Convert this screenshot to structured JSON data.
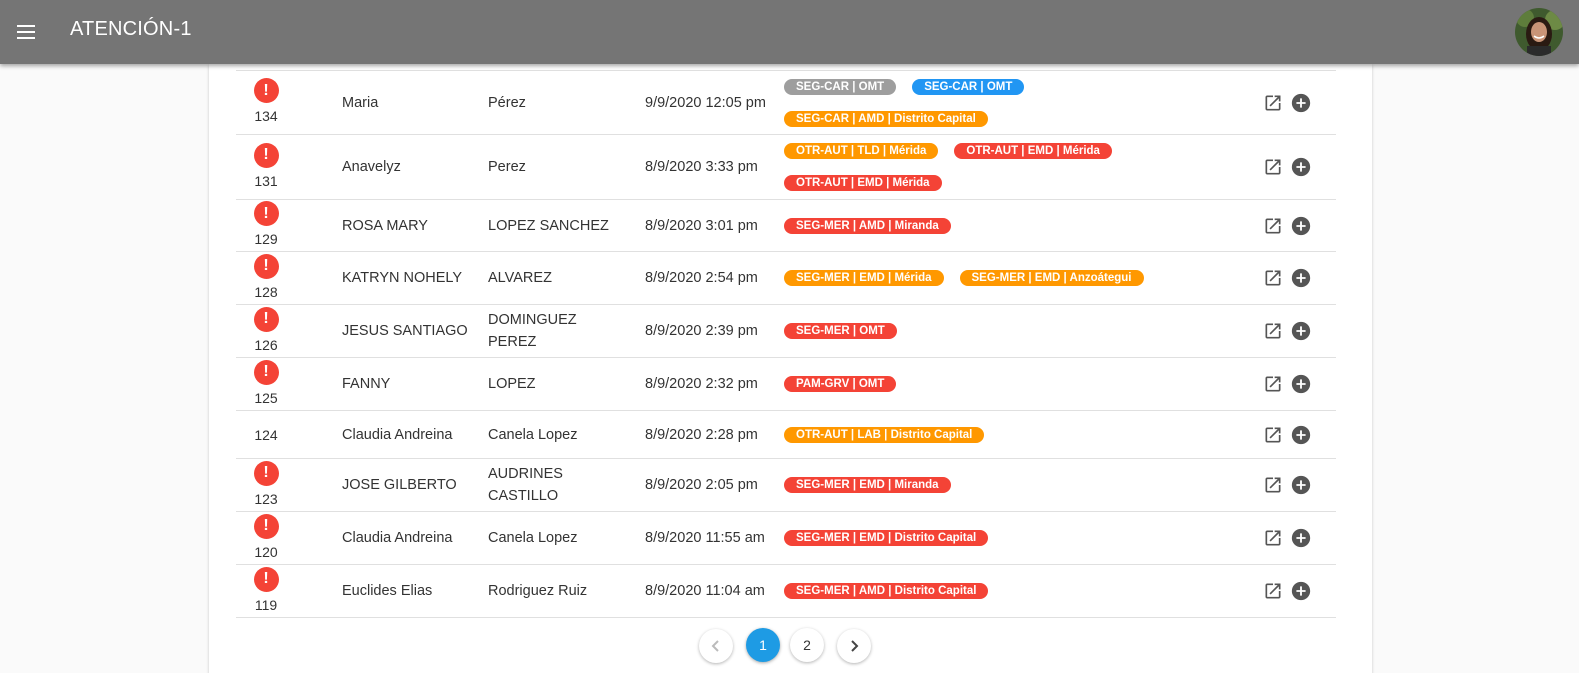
{
  "app": {
    "title": "ATENCIÓN-1"
  },
  "colors": {
    "red": "#f44336",
    "orange": "#ff9800",
    "gray": "#9e9e9e",
    "blue": "#2196f3",
    "active_page": "#1e9be4"
  },
  "rows": [
    {
      "id": "134",
      "alert": true,
      "first": "Maria",
      "last": "Pérez",
      "date": "9/9/2020 12:05 pm",
      "tags": [
        {
          "label": "SEG-CAR | OMT",
          "color": "gray"
        },
        {
          "label": "SEG-CAR | OMT",
          "color": "blue"
        },
        {
          "label": "SEG-CAR | AMD | Distrito Capital",
          "color": "orange"
        }
      ]
    },
    {
      "id": "131",
      "alert": true,
      "first": "Anavelyz",
      "last": "Perez",
      "date": "8/9/2020 3:33 pm",
      "tags": [
        {
          "label": "OTR-AUT | TLD | Mérida",
          "color": "orange"
        },
        {
          "label": "OTR-AUT | EMD | Mérida",
          "color": "red"
        },
        {
          "label": "OTR-AUT | EMD | Mérida",
          "color": "red"
        }
      ]
    },
    {
      "id": "129",
      "alert": true,
      "first": "ROSA MARY",
      "last": "LOPEZ SANCHEZ",
      "date": "8/9/2020 3:01 pm",
      "tags": [
        {
          "label": "SEG-MER | AMD | Miranda",
          "color": "red"
        }
      ]
    },
    {
      "id": "128",
      "alert": true,
      "first": "KATRYN NOHELY",
      "last": "ALVAREZ",
      "date": "8/9/2020 2:54 pm",
      "tags": [
        {
          "label": "SEG-MER | EMD | Mérida",
          "color": "orange"
        },
        {
          "label": "SEG-MER | EMD | Anzoátegui",
          "color": "orange"
        }
      ]
    },
    {
      "id": "126",
      "alert": true,
      "first": "JESUS SANTIAGO",
      "last": "DOMINGUEZ PEREZ",
      "date": "8/9/2020 2:39 pm",
      "tags": [
        {
          "label": "SEG-MER | OMT",
          "color": "red"
        }
      ]
    },
    {
      "id": "125",
      "alert": true,
      "first": "FANNY",
      "last": "LOPEZ",
      "date": "8/9/2020 2:32 pm",
      "tags": [
        {
          "label": "PAM-GRV | OMT",
          "color": "red"
        }
      ]
    },
    {
      "id": "124",
      "alert": false,
      "first": "Claudia Andreina",
      "last": "Canela Lopez",
      "date": "8/9/2020 2:28 pm",
      "tags": [
        {
          "label": "OTR-AUT | LAB | Distrito Capital",
          "color": "orange"
        }
      ]
    },
    {
      "id": "123",
      "alert": true,
      "first": "JOSE GILBERTO",
      "last": "AUDRINES CASTILLO",
      "date": "8/9/2020 2:05 pm",
      "tags": [
        {
          "label": "SEG-MER | EMD | Miranda",
          "color": "red"
        }
      ]
    },
    {
      "id": "120",
      "alert": true,
      "first": "Claudia Andreina",
      "last": "Canela Lopez",
      "date": "8/9/2020 11:55 am",
      "tags": [
        {
          "label": "SEG-MER | EMD | Distrito Capital",
          "color": "red"
        }
      ]
    },
    {
      "id": "119",
      "alert": true,
      "first": "Euclides Elias",
      "last": "Rodriguez Ruiz",
      "date": "8/9/2020 11:04 am",
      "tags": [
        {
          "label": "SEG-MER | AMD | Distrito Capital",
          "color": "red"
        }
      ]
    }
  ],
  "pagination": {
    "pages": [
      "1",
      "2"
    ],
    "current": "1"
  }
}
